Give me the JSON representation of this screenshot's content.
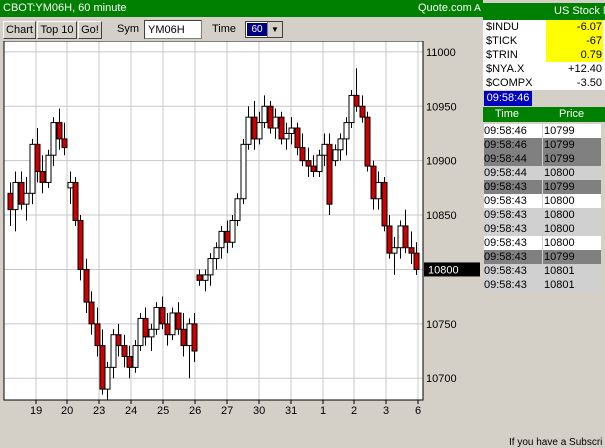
{
  "chart_window": {
    "title": "CBOT:YM06H, 60 minute",
    "brand": "Quote.com",
    "sys_button": "A"
  },
  "toolbar": {
    "chart_label": "Chart",
    "top10_label": "Top 10",
    "go_label": "Go!",
    "sym_label": "Sym",
    "sym_value": "YM06H",
    "time_label": "Time",
    "time_value": "60"
  },
  "chart_data": {
    "type": "candlestick",
    "title": "",
    "xlabel": "",
    "ylabel": "",
    "ylim": [
      10680,
      10810
    ],
    "yticks": [
      10700,
      10750,
      10800,
      10850,
      10900,
      10950,
      11000
    ],
    "ytick_labels": [
      "10700",
      "10750",
      "10800",
      "10850",
      "10900",
      "10950",
      "11000"
    ],
    "xtick_labels": [
      "19",
      "20",
      "23",
      "24",
      "25",
      "26",
      "27",
      "30",
      "31",
      "1",
      "2",
      "3",
      "6"
    ],
    "last_price": 10800,
    "last_price_label": "10800",
    "up_color": "#ffffff",
    "down_color": "#cc0000",
    "grid": true,
    "bars": [
      {
        "o": 10870,
        "h": 10880,
        "l": 10840,
        "c": 10855
      },
      {
        "o": 10855,
        "h": 10890,
        "l": 10835,
        "c": 10880
      },
      {
        "o": 10880,
        "h": 10890,
        "l": 10855,
        "c": 10860
      },
      {
        "o": 10860,
        "h": 10885,
        "l": 10845,
        "c": 10870
      },
      {
        "o": 10870,
        "h": 10920,
        "l": 10860,
        "c": 10915
      },
      {
        "o": 10915,
        "h": 10930,
        "l": 10880,
        "c": 10890
      },
      {
        "o": 10890,
        "h": 10905,
        "l": 10870,
        "c": 10880
      },
      {
        "o": 10880,
        "h": 10910,
        "l": 10875,
        "c": 10905
      },
      {
        "o": 10905,
        "h": 10940,
        "l": 10895,
        "c": 10935
      },
      {
        "o": 10935,
        "h": 10948,
        "l": 10910,
        "c": 10920
      },
      {
        "o": 10920,
        "h": 10935,
        "l": 10905,
        "c": 10912
      },
      {
        "o": 10875,
        "h": 10890,
        "l": 10860,
        "c": 10880
      },
      {
        "o": 10880,
        "h": 10885,
        "l": 10840,
        "c": 10845
      },
      {
        "o": 10845,
        "h": 10850,
        "l": 10790,
        "c": 10800
      },
      {
        "o": 10800,
        "h": 10810,
        "l": 10760,
        "c": 10770
      },
      {
        "o": 10770,
        "h": 10780,
        "l": 10740,
        "c": 10750
      },
      {
        "o": 10750,
        "h": 10765,
        "l": 10720,
        "c": 10730
      },
      {
        "o": 10730,
        "h": 10745,
        "l": 10685,
        "c": 10690
      },
      {
        "o": 10690,
        "h": 10715,
        "l": 10680,
        "c": 10710
      },
      {
        "o": 10710,
        "h": 10745,
        "l": 10700,
        "c": 10740
      },
      {
        "o": 10740,
        "h": 10750,
        "l": 10720,
        "c": 10730
      },
      {
        "o": 10730,
        "h": 10740,
        "l": 10710,
        "c": 10720
      },
      {
        "o": 10720,
        "h": 10730,
        "l": 10700,
        "c": 10710
      },
      {
        "o": 10710,
        "h": 10735,
        "l": 10705,
        "c": 10730
      },
      {
        "o": 10730,
        "h": 10760,
        "l": 10725,
        "c": 10755
      },
      {
        "o": 10755,
        "h": 10765,
        "l": 10730,
        "c": 10738
      },
      {
        "o": 10738,
        "h": 10750,
        "l": 10725,
        "c": 10745
      },
      {
        "o": 10745,
        "h": 10770,
        "l": 10740,
        "c": 10765
      },
      {
        "o": 10765,
        "h": 10775,
        "l": 10745,
        "c": 10750
      },
      {
        "o": 10750,
        "h": 10760,
        "l": 10730,
        "c": 10740
      },
      {
        "o": 10740,
        "h": 10765,
        "l": 10735,
        "c": 10760
      },
      {
        "o": 10760,
        "h": 10770,
        "l": 10740,
        "c": 10745
      },
      {
        "o": 10745,
        "h": 10760,
        "l": 10720,
        "c": 10730
      },
      {
        "o": 10730,
        "h": 10755,
        "l": 10700,
        "c": 10750
      },
      {
        "o": 10750,
        "h": 10760,
        "l": 10715,
        "c": 10725
      },
      {
        "o": 10795,
        "h": 10800,
        "l": 10785,
        "c": 10790
      },
      {
        "o": 10790,
        "h": 10800,
        "l": 10780,
        "c": 10795
      },
      {
        "o": 10795,
        "h": 10815,
        "l": 10785,
        "c": 10810
      },
      {
        "o": 10810,
        "h": 10825,
        "l": 10800,
        "c": 10820
      },
      {
        "o": 10820,
        "h": 10840,
        "l": 10810,
        "c": 10835
      },
      {
        "o": 10835,
        "h": 10845,
        "l": 10815,
        "c": 10825
      },
      {
        "o": 10825,
        "h": 10850,
        "l": 10820,
        "c": 10845
      },
      {
        "o": 10845,
        "h": 10870,
        "l": 10840,
        "c": 10865
      },
      {
        "o": 10865,
        "h": 10920,
        "l": 10860,
        "c": 10915
      },
      {
        "o": 10915,
        "h": 10950,
        "l": 10910,
        "c": 10940
      },
      {
        "o": 10940,
        "h": 10955,
        "l": 10910,
        "c": 10920
      },
      {
        "o": 10920,
        "h": 10945,
        "l": 10915,
        "c": 10935
      },
      {
        "o": 10935,
        "h": 10960,
        "l": 10930,
        "c": 10950
      },
      {
        "o": 10950,
        "h": 10955,
        "l": 10925,
        "c": 10930
      },
      {
        "o": 10930,
        "h": 10948,
        "l": 10920,
        "c": 10940
      },
      {
        "o": 10940,
        "h": 10945,
        "l": 10915,
        "c": 10920
      },
      {
        "o": 10920,
        "h": 10935,
        "l": 10910,
        "c": 10925
      },
      {
        "o": 10925,
        "h": 10940,
        "l": 10915,
        "c": 10930
      },
      {
        "o": 10930,
        "h": 10935,
        "l": 10905,
        "c": 10912
      },
      {
        "o": 10912,
        "h": 10925,
        "l": 10895,
        "c": 10900
      },
      {
        "o": 10900,
        "h": 10912,
        "l": 10885,
        "c": 10895
      },
      {
        "o": 10895,
        "h": 10905,
        "l": 10885,
        "c": 10890
      },
      {
        "o": 10890,
        "h": 10910,
        "l": 10885,
        "c": 10905
      },
      {
        "o": 10905,
        "h": 10925,
        "l": 10895,
        "c": 10915
      },
      {
        "o": 10915,
        "h": 10925,
        "l": 10850,
        "c": 10860
      },
      {
        "o": 10900,
        "h": 10915,
        "l": 10895,
        "c": 10910
      },
      {
        "o": 10910,
        "h": 10925,
        "l": 10900,
        "c": 10920
      },
      {
        "o": 10920,
        "h": 10940,
        "l": 10905,
        "c": 10935
      },
      {
        "o": 10935,
        "h": 10965,
        "l": 10930,
        "c": 10960
      },
      {
        "o": 10960,
        "h": 10985,
        "l": 10945,
        "c": 10950
      },
      {
        "o": 10950,
        "h": 10960,
        "l": 10935,
        "c": 10940
      },
      {
        "o": 10940,
        "h": 10945,
        "l": 10890,
        "c": 10895
      },
      {
        "o": 10895,
        "h": 10900,
        "l": 10855,
        "c": 10865
      },
      {
        "o": 10865,
        "h": 10890,
        "l": 10855,
        "c": 10880
      },
      {
        "o": 10880,
        "h": 10885,
        "l": 10835,
        "c": 10840
      },
      {
        "o": 10840,
        "h": 10850,
        "l": 10810,
        "c": 10815
      },
      {
        "o": 10815,
        "h": 10830,
        "l": 10795,
        "c": 10820
      },
      {
        "o": 10820,
        "h": 10845,
        "l": 10810,
        "c": 10840
      },
      {
        "o": 10840,
        "h": 10855,
        "l": 10815,
        "c": 10820
      },
      {
        "o": 10820,
        "h": 10835,
        "l": 10805,
        "c": 10815
      },
      {
        "o": 10815,
        "h": 10825,
        "l": 10795,
        "c": 10800
      }
    ]
  },
  "right_panel": {
    "title": "US Stock M",
    "indices": [
      {
        "symbol": "$INDU",
        "value": "-6.07",
        "highlight": true
      },
      {
        "symbol": "$TICK",
        "value": "-67",
        "highlight": true
      },
      {
        "symbol": "$TRIN",
        "value": "0.79",
        "highlight": true
      },
      {
        "symbol": "$NYA.X",
        "value": "+12.40",
        "highlight": false
      },
      {
        "symbol": "$COMPX",
        "value": "-3.50",
        "highlight": false
      }
    ],
    "clock": "09:58:46",
    "ts_headers": {
      "time": "Time",
      "price": "Price"
    },
    "trades": [
      {
        "time": "09:58:46",
        "price": "10799",
        "shade": "light"
      },
      {
        "time": "09:58:46",
        "price": "10799",
        "shade": "dark"
      },
      {
        "time": "09:58:44",
        "price": "10799",
        "shade": "dark"
      },
      {
        "time": "09:58:44",
        "price": "10800",
        "shade": "mid"
      },
      {
        "time": "09:58:43",
        "price": "10799",
        "shade": "dark"
      },
      {
        "time": "09:58:43",
        "price": "10800",
        "shade": "light"
      },
      {
        "time": "09:58:43",
        "price": "10800",
        "shade": "mid"
      },
      {
        "time": "09:58:43",
        "price": "10800",
        "shade": "mid"
      },
      {
        "time": "09:58:43",
        "price": "10800",
        "shade": "light"
      },
      {
        "time": "09:58:43",
        "price": "10799",
        "shade": "dark"
      },
      {
        "time": "09:58:43",
        "price": "10801",
        "shade": "mid"
      },
      {
        "time": "09:58:43",
        "price": "10801",
        "shade": "mid"
      }
    ],
    "subscribe_msg": "If you have a Subscri"
  }
}
